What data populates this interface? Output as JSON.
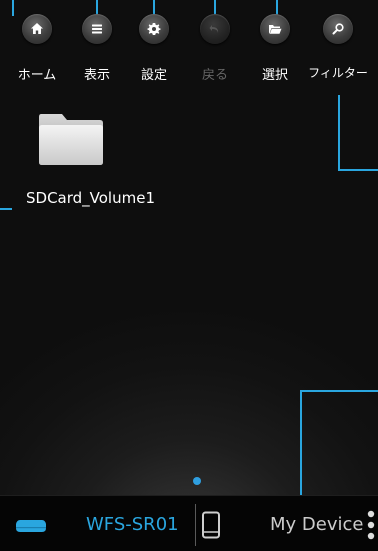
{
  "toolbar": {
    "items": [
      {
        "label": "ホーム",
        "icon": "home-icon"
      },
      {
        "label": "表示",
        "icon": "list-icon"
      },
      {
        "label": "設定",
        "icon": "gear-icon"
      },
      {
        "label": "戻る",
        "icon": "back-icon",
        "disabled": true
      },
      {
        "label": "選択",
        "icon": "folder-open-icon"
      },
      {
        "label": "フィルター",
        "icon": "search-icon"
      }
    ]
  },
  "content": {
    "folder": {
      "name": "SDCard_Volume1",
      "icon": "folder-icon"
    }
  },
  "bottom_bar": {
    "device_name": "WFS-SR01",
    "other_tab": "My Device",
    "icons": [
      "storage-device-icon",
      "phone-icon",
      "more-vertical-icon"
    ]
  },
  "colors": {
    "accent": "#2aa6df",
    "background": "#121212",
    "bottom_bar": "#050505"
  }
}
